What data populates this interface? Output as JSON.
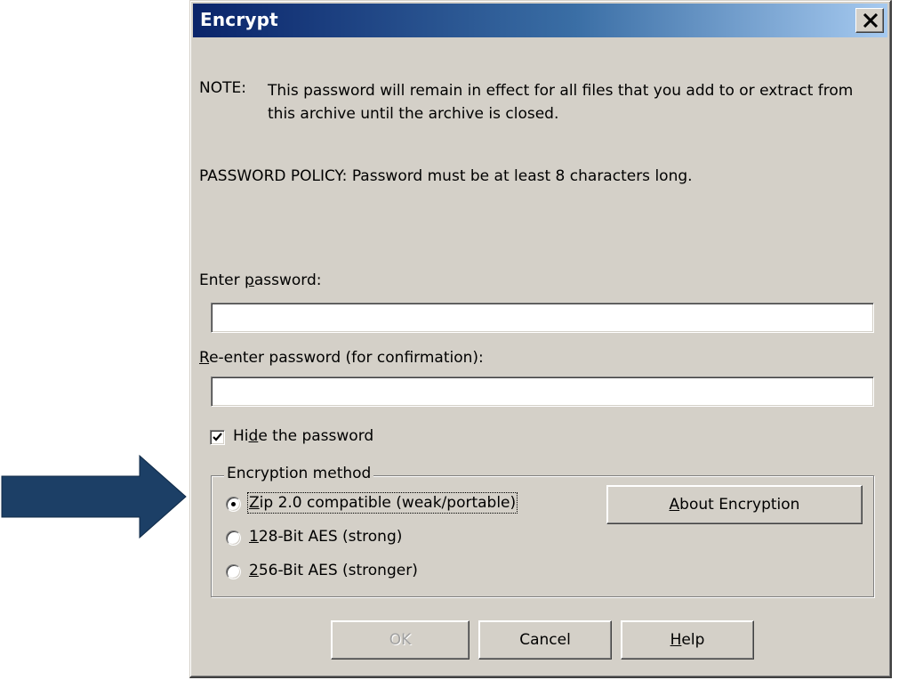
{
  "window": {
    "title": "Encrypt",
    "close_icon": "close-icon"
  },
  "note": {
    "label": "NOTE:",
    "text": "This password will remain in effect for all files that you add to or extract from this archive until the archive is closed."
  },
  "policy": "PASSWORD POLICY: Password must be at least 8 characters long.",
  "password": {
    "label_pre": "Enter ",
    "label_accel": "p",
    "label_post": "assword:",
    "value": ""
  },
  "confirm": {
    "label_accel": "R",
    "label_post": "e-enter password (for confirmation):",
    "value": ""
  },
  "hide_password": {
    "label_pre": "Hi",
    "label_accel": "d",
    "label_post": "e the password",
    "checked": true
  },
  "encryption": {
    "legend": "Encryption method",
    "options": [
      {
        "accel": "Z",
        "rest": "ip 2.0 compatible (weak/portable)",
        "selected": true
      },
      {
        "accel": "1",
        "rest": "28-Bit AES (strong)",
        "selected": false
      },
      {
        "accel": "2",
        "rest": "56-Bit AES (stronger)",
        "selected": false
      }
    ],
    "about_button": {
      "accel": "A",
      "rest": "bout Encryption"
    }
  },
  "buttons": {
    "ok": "OK",
    "cancel": "Cancel",
    "help_accel": "H",
    "help_rest": "elp"
  },
  "colors": {
    "arrow": "#1c3f66",
    "title_start": "#0a246a",
    "title_end": "#a6caf0",
    "dialog_face": "#d4d0c8"
  }
}
